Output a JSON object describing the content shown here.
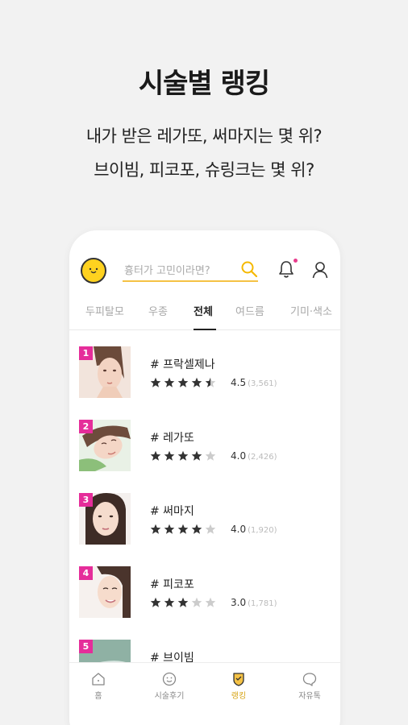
{
  "promo": {
    "title": "시술별 랭킹",
    "subtitle_line1": "내가 받은 레가또, 써마지는 몇 위?",
    "subtitle_line2": "브이빔, 피코포, 슈링크는 몇 위?"
  },
  "app": {
    "search": {
      "placeholder": "흉터가 고민이라면?"
    },
    "icons": {
      "logo": "smile-face-logo",
      "search": "search-icon",
      "bell": "bell-icon",
      "profile": "person-icon"
    },
    "colors": {
      "accent": "#f5c245",
      "rank_badge": "#e52d9a",
      "notification_dot": "#e83c8d",
      "star_filled": "#333333",
      "star_empty": "#cccccc"
    },
    "tabs": [
      {
        "label": "두피탈모",
        "active": false
      },
      {
        "label": "우종",
        "active": false
      },
      {
        "label": "전체",
        "active": true
      },
      {
        "label": "여드름",
        "active": false
      },
      {
        "label": "기미·색소",
        "active": false
      }
    ],
    "ranking": [
      {
        "rank": "1",
        "name": "# 프락셀제나",
        "rating": 4.5,
        "score": "4.5",
        "count": "(3,561)"
      },
      {
        "rank": "2",
        "name": "# 레가또",
        "rating": 4.0,
        "score": "4.0",
        "count": "(2,426)"
      },
      {
        "rank": "3",
        "name": "# 써마지",
        "rating": 4.0,
        "score": "4.0",
        "count": "(1,920)"
      },
      {
        "rank": "4",
        "name": "# 피코포",
        "rating": 3.0,
        "score": "3.0",
        "count": "(1,781)"
      },
      {
        "rank": "5",
        "name": "# 브이빔",
        "rating": null,
        "score": "",
        "count": ""
      }
    ],
    "bottom_nav": [
      {
        "label": "홈",
        "icon": "home-icon",
        "active": false
      },
      {
        "label": "시술후기",
        "icon": "smile-icon",
        "active": false
      },
      {
        "label": "랭킹",
        "icon": "ranking-icon",
        "active": true
      },
      {
        "label": "자유톡",
        "icon": "chat-icon",
        "active": false
      }
    ]
  }
}
